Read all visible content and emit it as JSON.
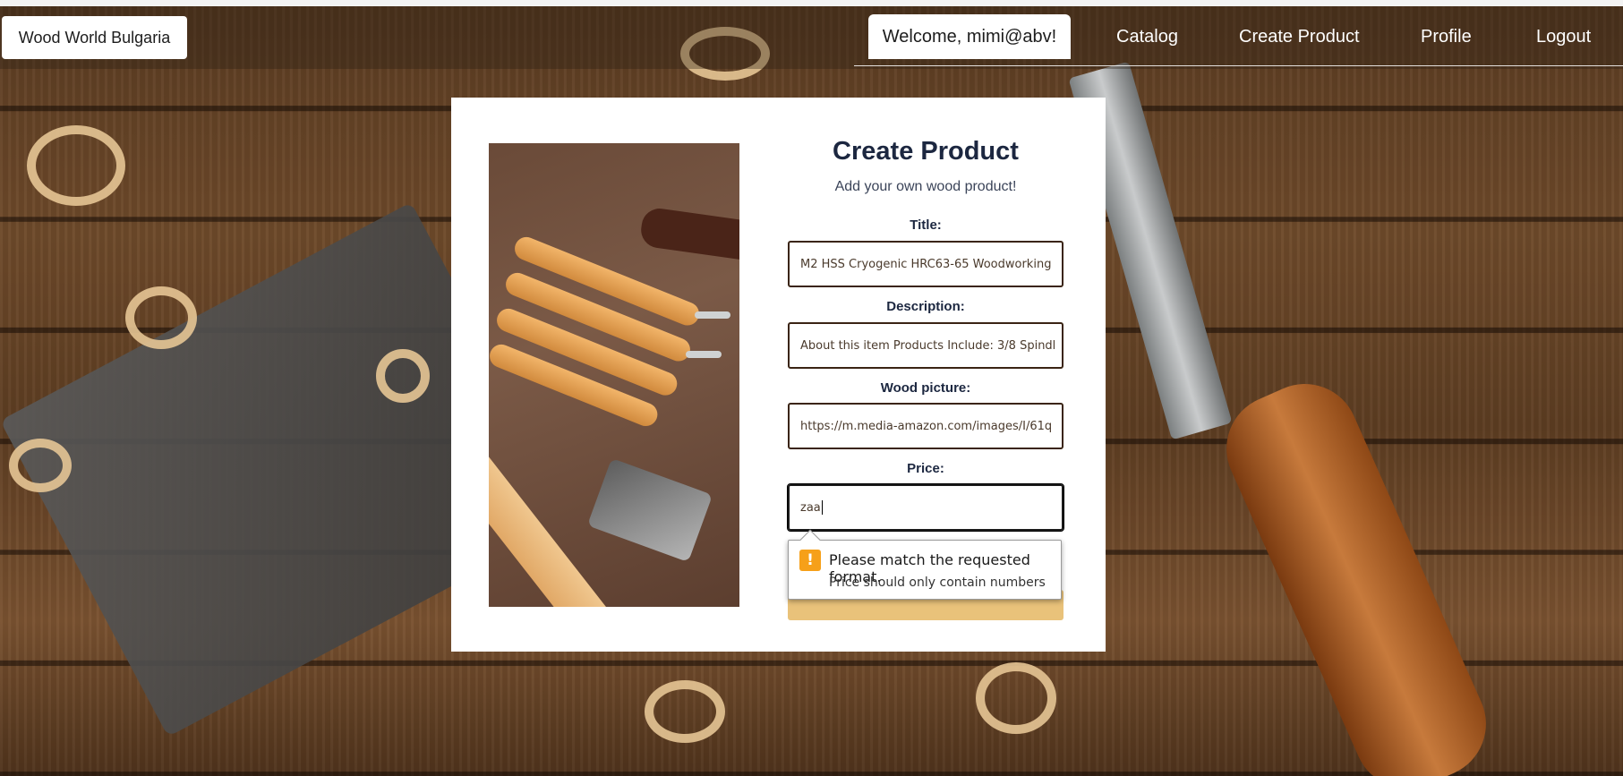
{
  "navbar": {
    "brand": "Wood World Bulgaria",
    "welcome": "Welcome, mimi@abv!",
    "links": [
      "Catalog",
      "Create Product",
      "Profile",
      "Logout"
    ]
  },
  "form": {
    "title": "Create Product",
    "subtitle": "Add your own wood product!",
    "fields": [
      {
        "label": "Title:",
        "value": "M2 HSS Cryogenic HRC63-65 Woodworking"
      },
      {
        "label": "Description:",
        "value": "About this item Products Include: 3/8 Spindl"
      },
      {
        "label": "Wood picture:",
        "value": "https://m.media-amazon.com/images/I/61q"
      },
      {
        "label": "Price:",
        "value": "zaa"
      }
    ]
  },
  "validation": {
    "icon": "warning-icon",
    "message": "Please match the requested format.",
    "hint": "Price should only contain numbers",
    "icon_color": "#f6a019"
  },
  "colors": {
    "accent": "#e9c27a",
    "title": "#1c2740",
    "input_border": "#3a2414"
  }
}
